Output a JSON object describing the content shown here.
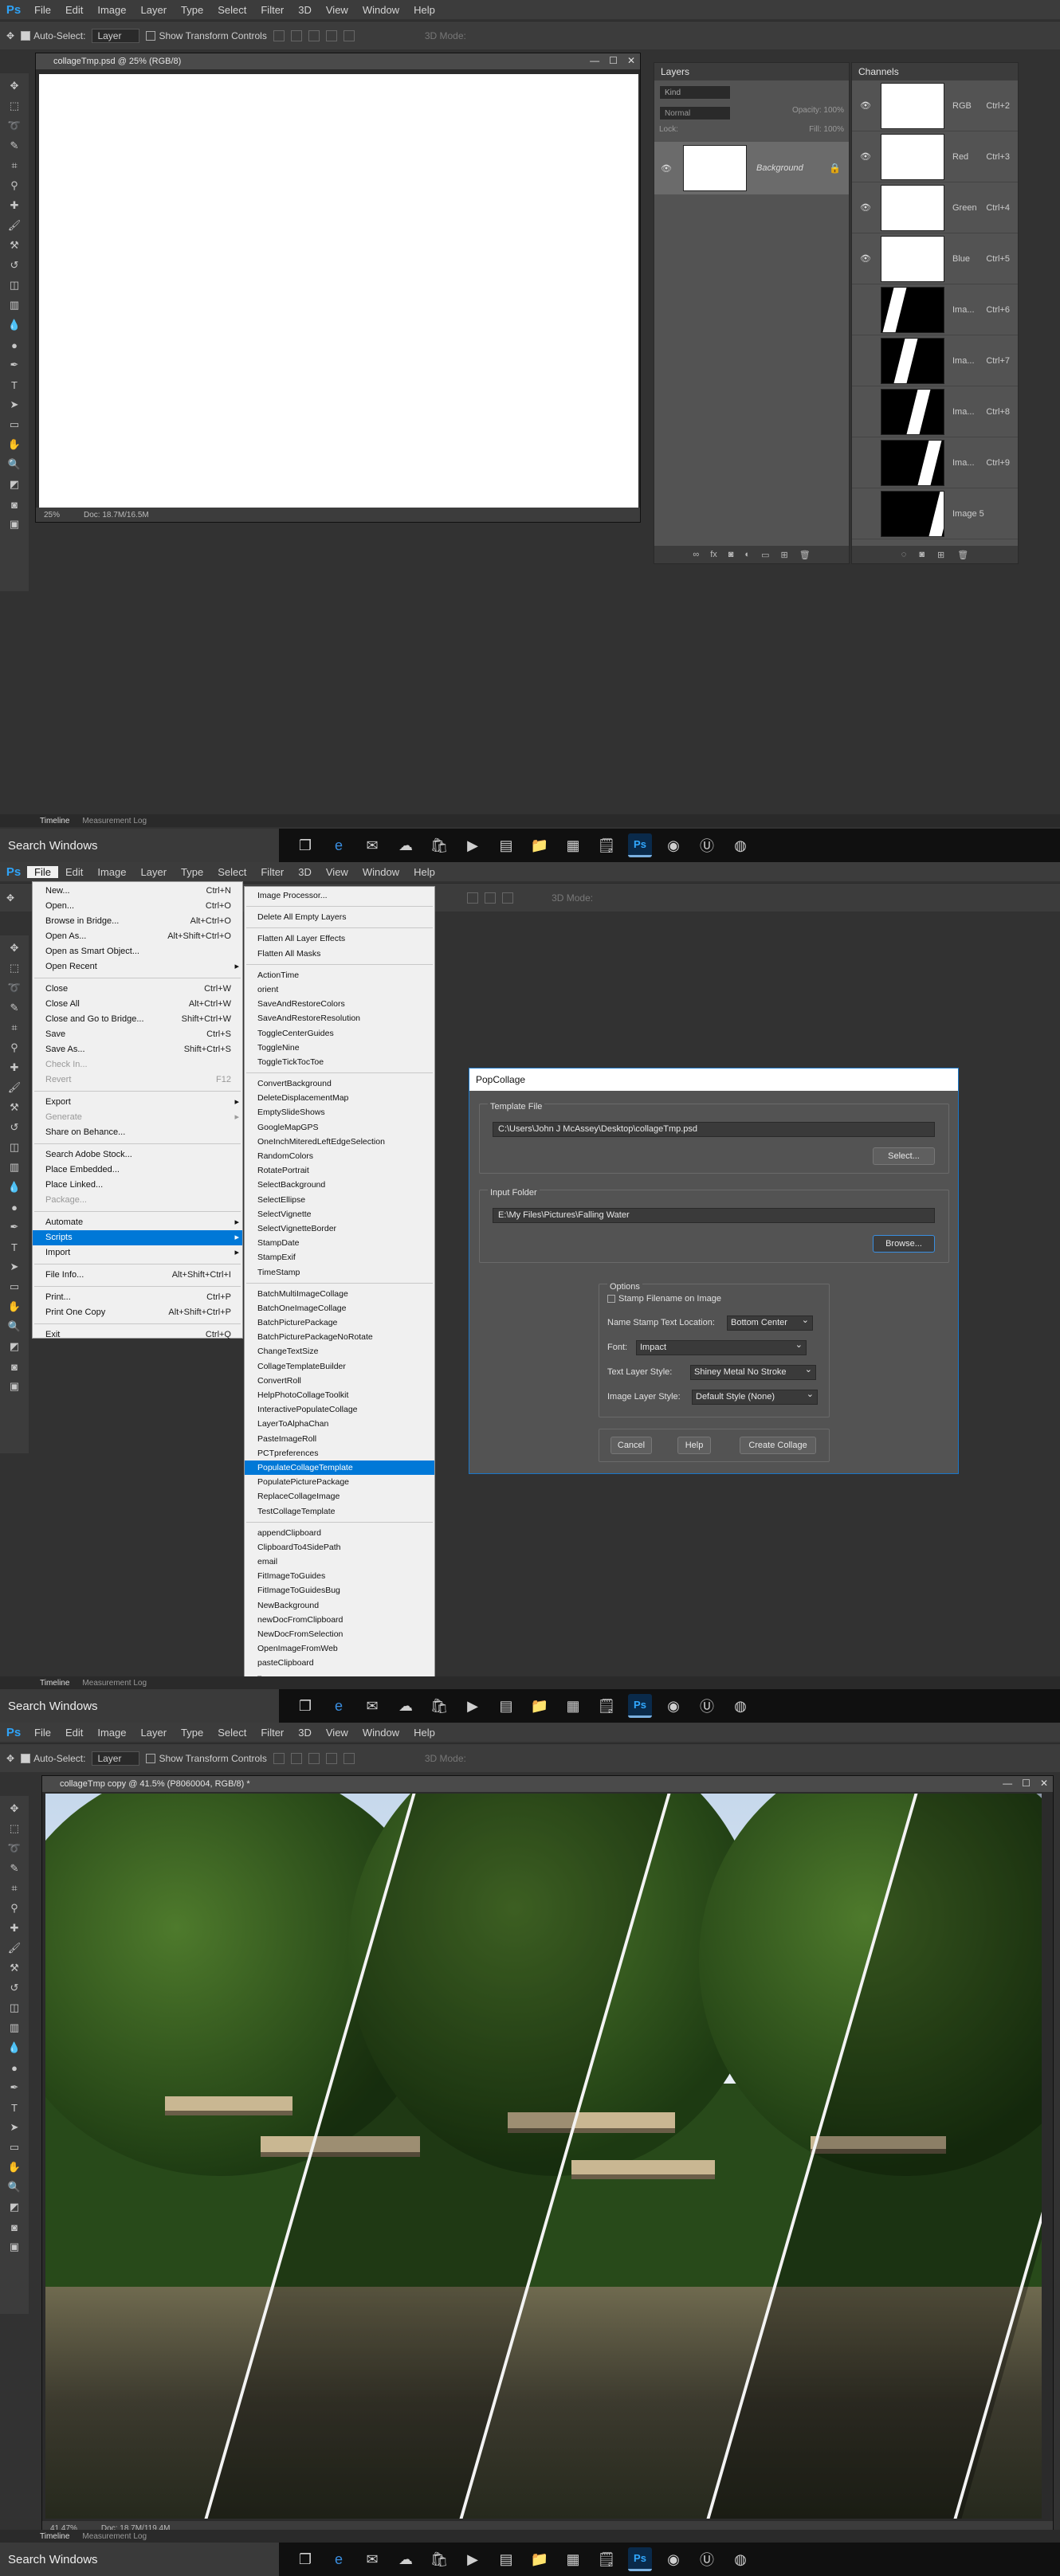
{
  "app": {
    "menu": [
      "File",
      "Edit",
      "Image",
      "Layer",
      "Type",
      "Select",
      "Filter",
      "3D",
      "View",
      "Window",
      "Help"
    ],
    "logo": "Ps"
  },
  "options": {
    "auto_select": "Auto-Select:",
    "auto_select_value": "Layer",
    "show_transform": "Show Transform Controls",
    "mode_3d": "3D Mode:"
  },
  "pane1": {
    "doc_title": "collageTmp.psd @ 25% (RGB/8)",
    "zoom": "25%",
    "doc_info": "Doc: 18.7M/16.5M",
    "layers": {
      "title": "Layers",
      "kind": "Kind",
      "blend": "Normal",
      "opacity": "Opacity:",
      "opacity_val": "100%",
      "lock": "Lock:",
      "fill": "Fill:",
      "fill_val": "100%",
      "layer_name": "Background"
    },
    "channels": {
      "title": "Channels",
      "rows": [
        {
          "name": "RGB",
          "key": "Ctrl+2"
        },
        {
          "name": "Red",
          "key": "Ctrl+3"
        },
        {
          "name": "Green",
          "key": "Ctrl+4"
        },
        {
          "name": "Blue",
          "key": "Ctrl+5"
        },
        {
          "name": "Ima...",
          "key": "Ctrl+6"
        },
        {
          "name": "Ima...",
          "key": "Ctrl+7"
        },
        {
          "name": "Ima...",
          "key": "Ctrl+8"
        },
        {
          "name": "Ima...",
          "key": "Ctrl+9"
        },
        {
          "name": "Image 5",
          "key": ""
        }
      ]
    }
  },
  "bottom_tabs": {
    "timeline": "Timeline",
    "measurement": "Measurement Log"
  },
  "taskbar": {
    "search": "Search Windows"
  },
  "pane2": {
    "file_menu": [
      {
        "label": "New...",
        "key": "Ctrl+N"
      },
      {
        "label": "Open...",
        "key": "Ctrl+O"
      },
      {
        "label": "Browse in Bridge...",
        "key": "Alt+Ctrl+O"
      },
      {
        "label": "Open As...",
        "key": "Alt+Shift+Ctrl+O"
      },
      {
        "label": "Open as Smart Object...",
        "key": ""
      },
      {
        "label": "Open Recent",
        "key": ""
      },
      {
        "label": "Close",
        "key": "Ctrl+W"
      },
      {
        "label": "Close All",
        "key": "Alt+Ctrl+W"
      },
      {
        "label": "Close and Go to Bridge...",
        "key": "Shift+Ctrl+W"
      },
      {
        "label": "Save",
        "key": "Ctrl+S"
      },
      {
        "label": "Save As...",
        "key": "Shift+Ctrl+S"
      },
      {
        "label": "Check In...",
        "key": ""
      },
      {
        "label": "Revert",
        "key": "F12"
      },
      {
        "label": "Export",
        "key": ""
      },
      {
        "label": "Generate",
        "key": ""
      },
      {
        "label": "Share on Behance...",
        "key": ""
      },
      {
        "label": "Search Adobe Stock...",
        "key": ""
      },
      {
        "label": "Place Embedded...",
        "key": ""
      },
      {
        "label": "Place Linked...",
        "key": ""
      },
      {
        "label": "Package...",
        "key": ""
      },
      {
        "label": "Automate",
        "key": ""
      },
      {
        "label": "Scripts",
        "key": ""
      },
      {
        "label": "Import",
        "key": ""
      },
      {
        "label": "File Info...",
        "key": "Alt+Shift+Ctrl+I"
      },
      {
        "label": "Print...",
        "key": "Ctrl+P"
      },
      {
        "label": "Print One Copy",
        "key": "Alt+Shift+Ctrl+P"
      },
      {
        "label": "Exit",
        "key": "Ctrl+Q"
      }
    ],
    "scripts_menu": [
      "Image Processor...",
      "Delete All Empty Layers",
      "Flatten All Layer Effects",
      "Flatten All Masks",
      "ActionTime",
      "orient",
      "SaveAndRestoreColors",
      "SaveAndRestoreResolution",
      "ToggleCenterGuides",
      "ToggleNine",
      "ToggleTickTocToe",
      "ConvertBackground",
      "DeleteDisplacementMap",
      "EmptySlideShows",
      "GoogleMapGPS",
      "OneInchMiteredLeftEdgeSelection",
      "RandomColors",
      "RotatePortrait",
      "SelectBackground",
      "SelectEllipse",
      "SelectVignette",
      "SelectVignetteBorder",
      "StampDate",
      "StampExif",
      "TimeStamp",
      "BatchMultiImageCollage",
      "BatchOneImageCollage",
      "BatchPicturePackage",
      "BatchPicturePackageNoRotate",
      "ChangeTextSize",
      "CollageTemplateBuilder",
      "ConvertRoll",
      "HelpPhotoCollageToolkit",
      "InteractivePopulateCollage",
      "LayerToAlphaChan",
      "PasteImageRoll",
      "PCTpreferences",
      "PopulateCollageTemplate",
      "PopulatePicturePackage",
      "ReplaceCollageImage",
      "TestCollageTemplate",
      "appendClipboard",
      "ClipboardTo4SidePath",
      "email",
      "FitImageToGuides",
      "FitImageToGuidesBug",
      "NewBackground",
      "newDocFromClipboard",
      "NewDocFromSelection",
      "OpenImageFromWeb",
      "pasteClipboard",
      "▾"
    ],
    "dialog": {
      "title": "PopCollage",
      "template_group": "Template File",
      "template_path": "C:\\Users\\John J McAssey\\Desktop\\collageTmp.psd",
      "select_btn": "Select...",
      "input_group": "Input Folder",
      "input_path": "E:\\My Files\\Pictures\\Falling Water",
      "browse_btn": "Browse...",
      "options_group": "Options",
      "stamp": "Stamp Filename on Image",
      "name_loc_label": "Name Stamp Text  Location:",
      "name_loc": "Bottom Center",
      "font_label": "Font:",
      "font": "Impact",
      "text_style_label": "Text Layer Style:",
      "text_style": "Shiney Metal No Stroke",
      "image_style_label": "Image Layer Style:",
      "image_style": "Default Style (None)",
      "cancel": "Cancel",
      "help": "Help",
      "create": "Create Collage"
    }
  },
  "pane3": {
    "doc_title": "collageTmp copy @ 41.5% (P8060004, RGB/8) *",
    "zoom": "41.47%",
    "doc_info": "Doc: 18.7M/119.4M"
  }
}
